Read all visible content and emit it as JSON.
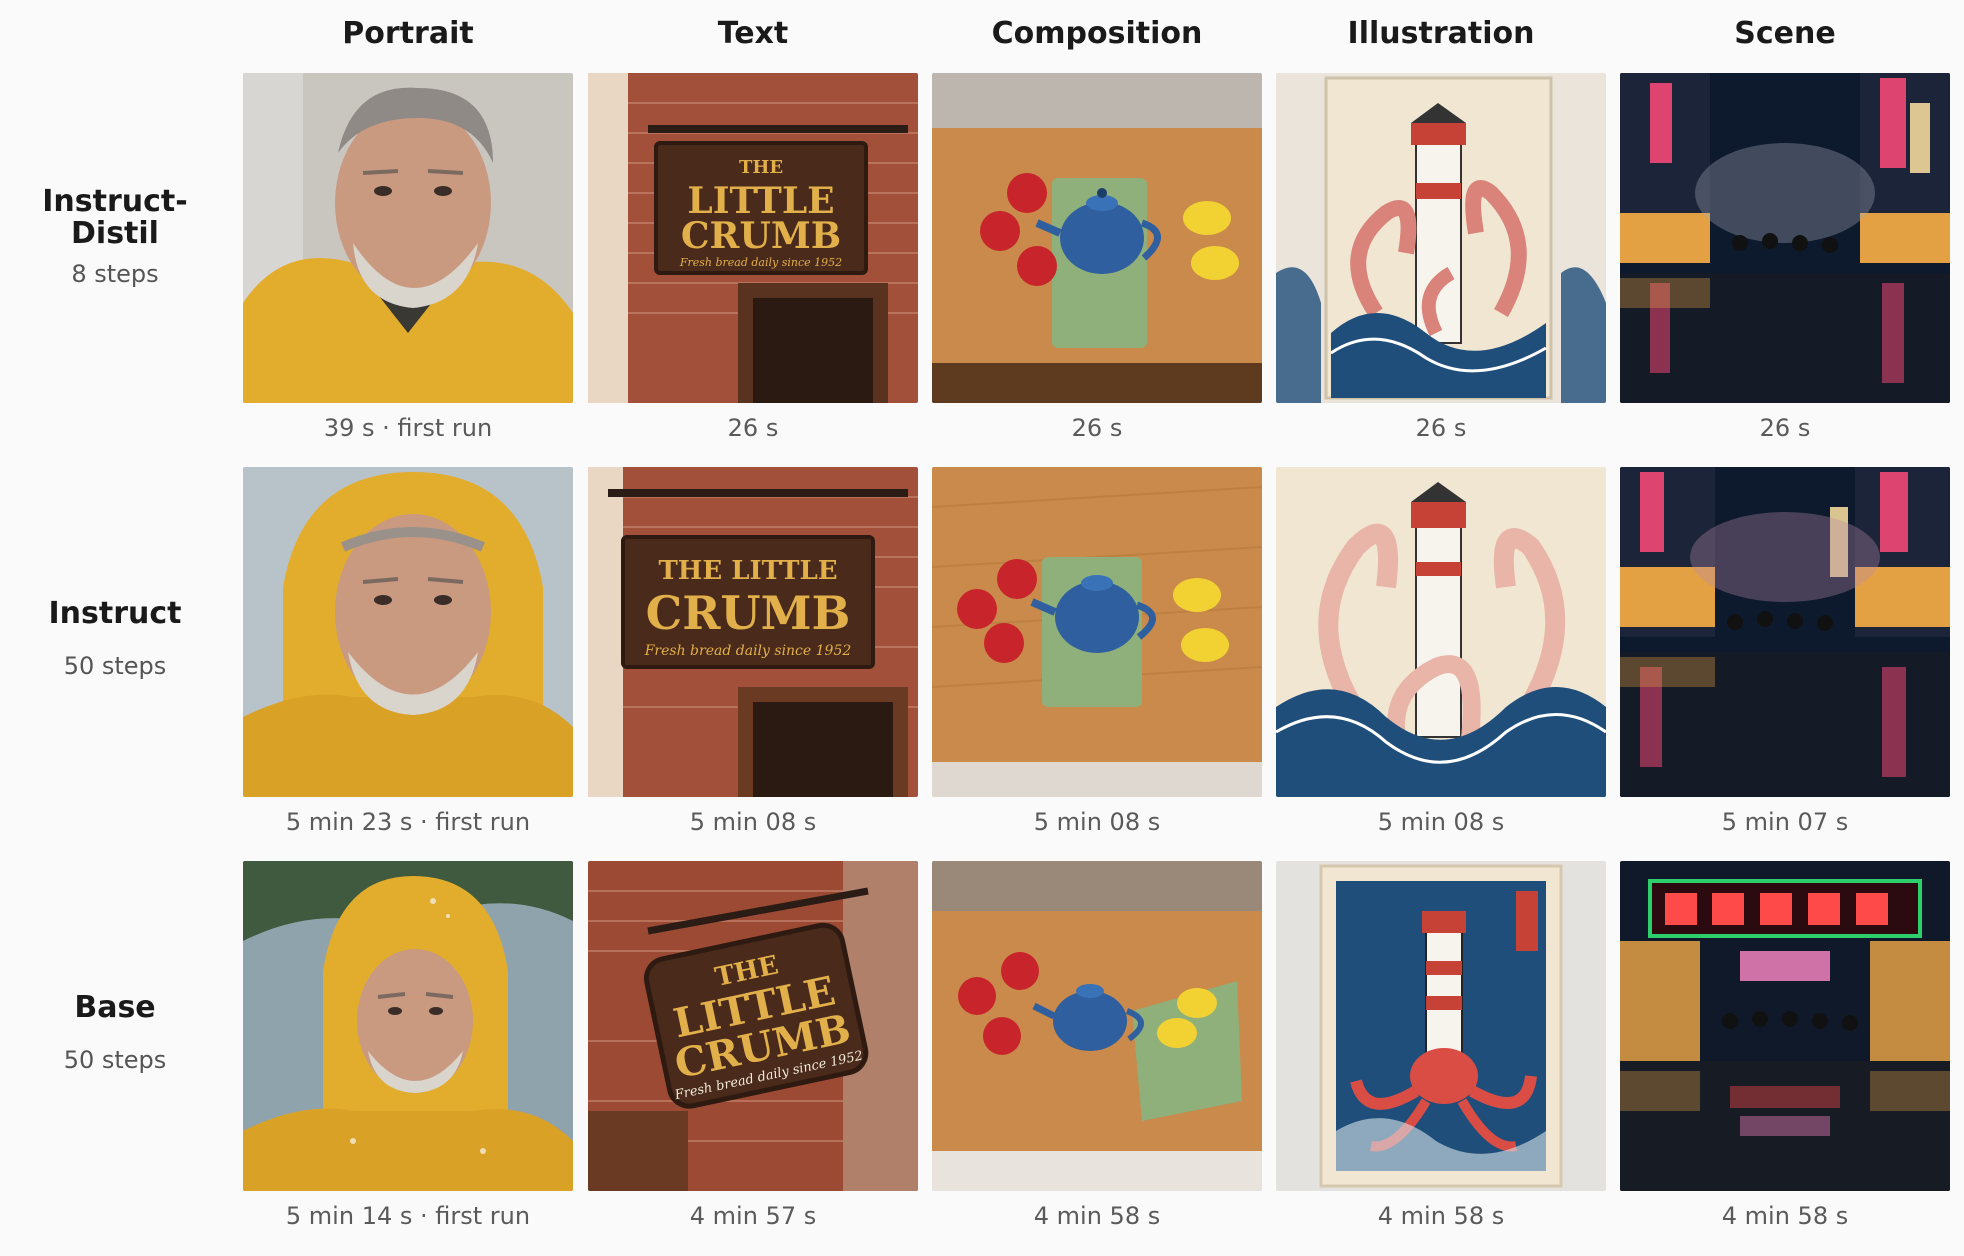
{
  "columns": [
    "Portrait",
    "Text",
    "Composition",
    "Illustration",
    "Scene"
  ],
  "rows": [
    {
      "title": "Instruct-\nDistil",
      "steps": "8 steps",
      "captions": [
        "39 s · first run",
        "26 s",
        "26 s",
        "26 s",
        "26 s"
      ]
    },
    {
      "title": "Instruct",
      "steps": "50 steps",
      "captions": [
        "5 min 23 s · first run",
        "5 min 08 s",
        "5 min 08 s",
        "5 min 08 s",
        "5 min 07 s"
      ]
    },
    {
      "title": "Base",
      "steps": "50 steps",
      "captions": [
        "5 min 14 s · first run",
        "4 min 57 s",
        "4 min 58 s",
        "4 min 58 s",
        "4 min 58 s"
      ]
    }
  ],
  "sign_text": {
    "line1": "THE",
    "line2": "LITTLE",
    "line3": "CRUMB",
    "tagline": "Fresh bread daily since 1952"
  },
  "palette": {
    "raincoat_yellow": "#e8b52c",
    "brick": "#9c4a34",
    "wood_sign": "#4a2a1a",
    "sign_lettering": "#e2b04a",
    "table_wood": "#c98a4b",
    "teapot_blue": "#2f5f9e",
    "apple_red": "#c8242b",
    "lemon_yellow": "#f2d232",
    "napkin_green": "#8fb07a",
    "paper_cream": "#f1e6d2",
    "wave_blue": "#1f4e7a",
    "octopus_pink": "#d9837a",
    "neon_pink": "#ff4a7a",
    "night_blue": "#0d1a2e"
  }
}
